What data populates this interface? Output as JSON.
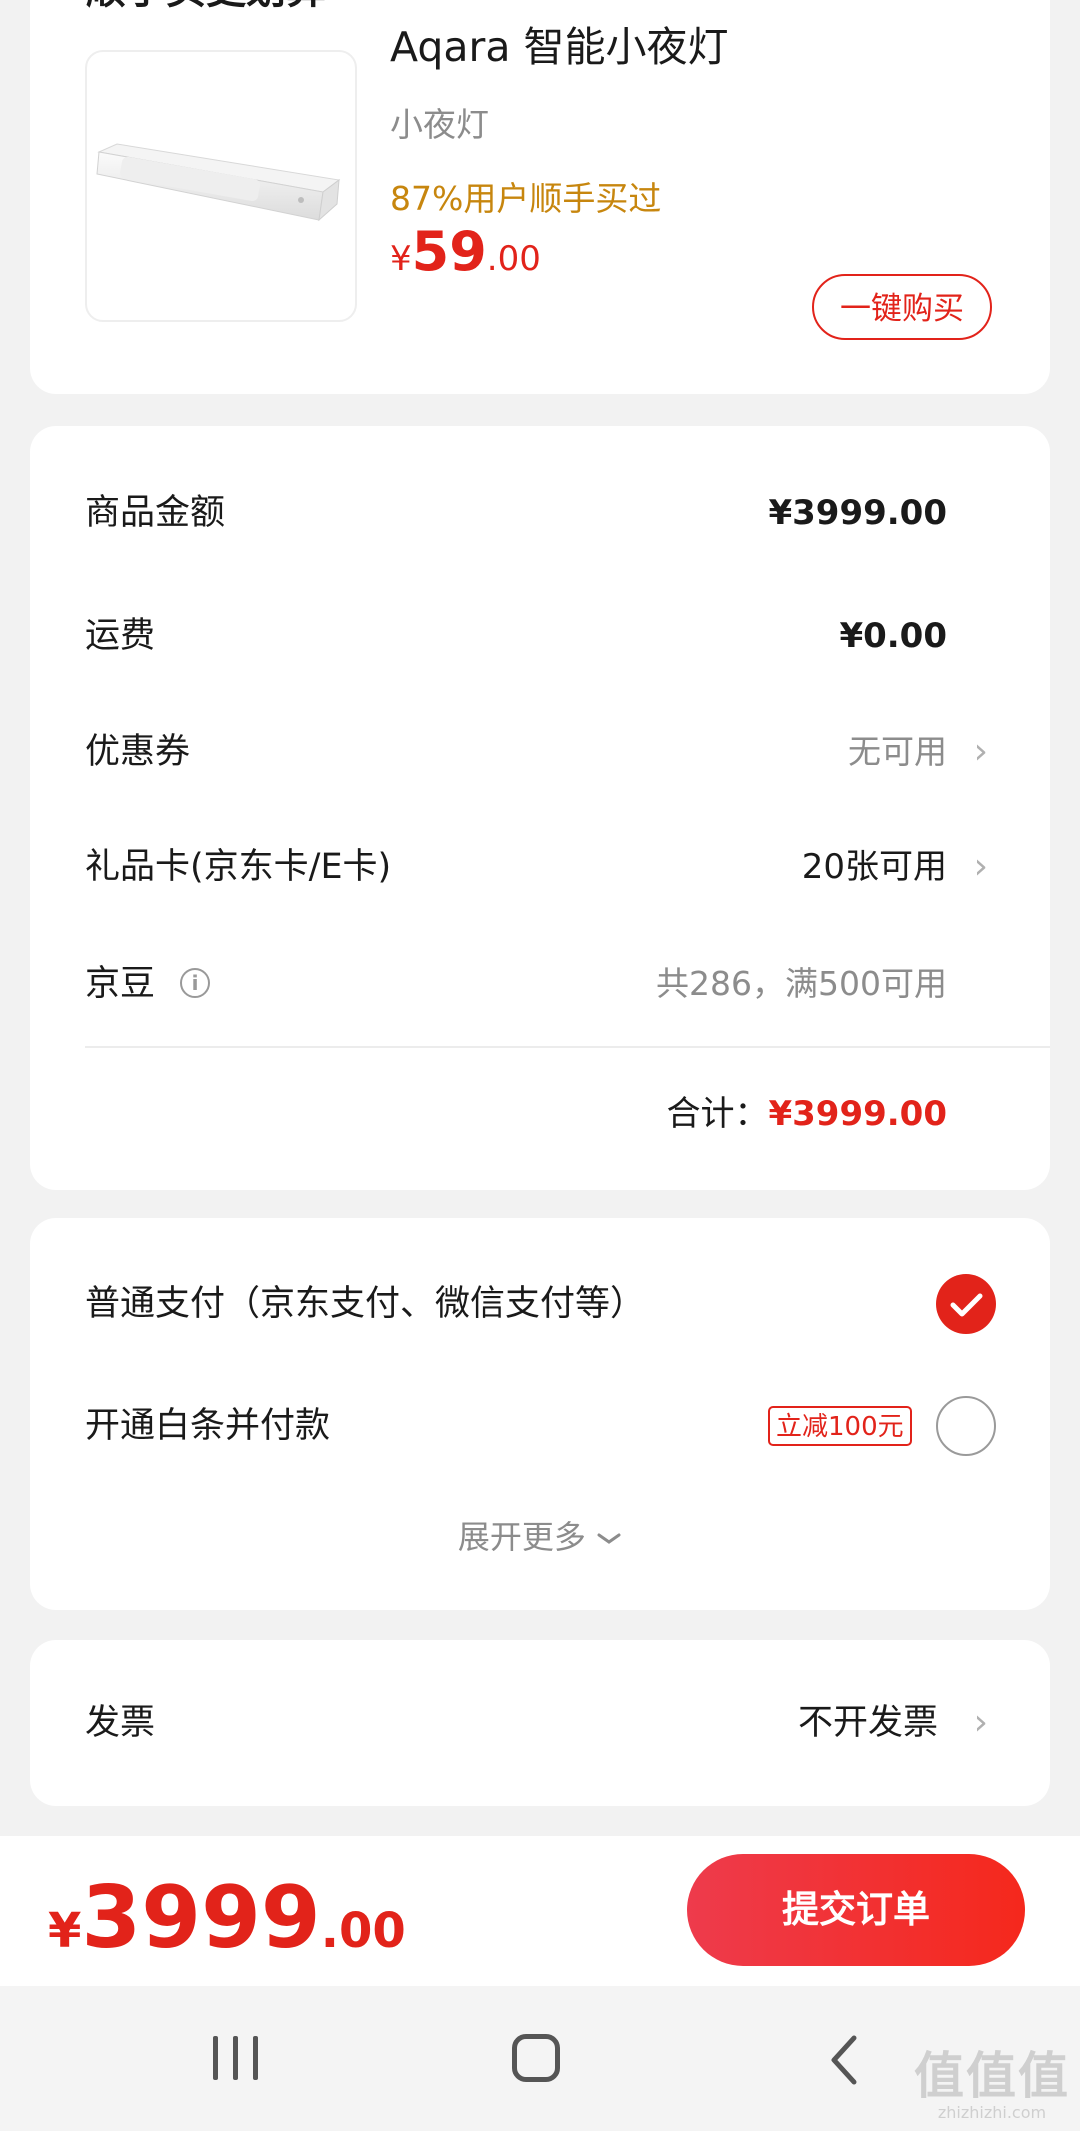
{
  "product_section": {
    "section_title": "顺手买更划算",
    "product": {
      "name": "Aqara 智能小夜灯",
      "subtitle": "小夜灯",
      "hint": "87%用户顺手买过",
      "price_currency": "¥",
      "price_int": "59",
      "price_dec": ".00",
      "buy_label": "一键购买"
    }
  },
  "summary": {
    "rows": [
      {
        "label": "商品金额",
        "value": "¥3999.00"
      },
      {
        "label": "运费",
        "value": "¥0.00"
      },
      {
        "label": "优惠券",
        "value": "无可用"
      },
      {
        "label": "礼品卡(京东卡/E卡)",
        "value": "20张可用"
      },
      {
        "label": "京豆",
        "value": "共286，满500可用"
      }
    ],
    "total_label": "合计：",
    "total_value": "¥3999.00"
  },
  "payment": {
    "options": [
      {
        "label": "普通支付（京东支付、微信支付等）",
        "selected": true
      },
      {
        "label": "开通白条并付款",
        "selected": false,
        "tag": "立减100元"
      }
    ],
    "expand_label": "展开更多"
  },
  "invoice": {
    "label": "发票",
    "value": "不开发票"
  },
  "bottom_bar": {
    "price_currency": "¥",
    "price_int": "3999",
    "price_dec": ".00",
    "submit_label": "提交订单"
  },
  "watermark": {
    "big": "值值值",
    "small": "zhizhizhi.com"
  },
  "colors": {
    "accent_red": "#e2231a",
    "hint_orange": "#c7860e",
    "background": "#f2f2f2"
  },
  "icons": [
    "info-icon",
    "chevron-right-icon",
    "check-icon",
    "chevron-down-icon",
    "nav-recents-icon",
    "nav-home-icon",
    "nav-back-icon"
  ]
}
